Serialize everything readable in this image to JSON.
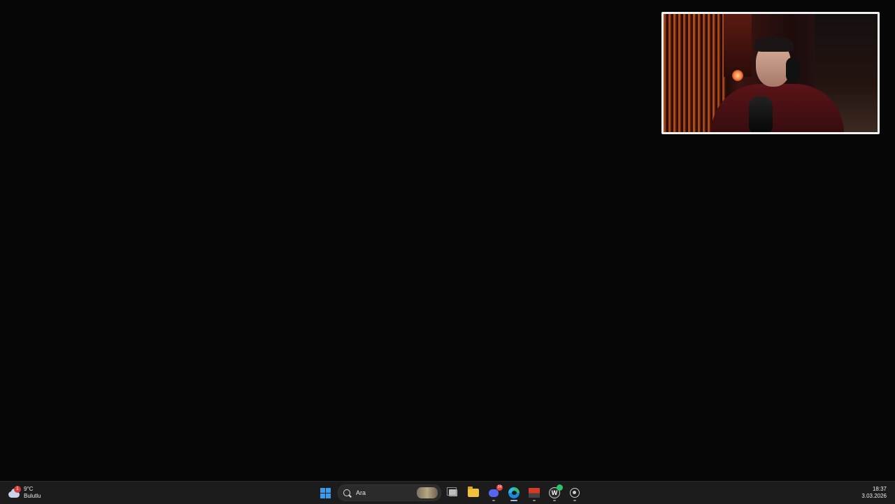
{
  "webcam": {
    "description_label": "webcam overlay"
  },
  "taskbar": {
    "weather": {
      "temperature": "9°C",
      "condition": "Bulutlu",
      "badge": "1"
    },
    "search": {
      "placeholder": "Ara"
    },
    "apps": [
      {
        "name": "start",
        "icon": "windows-logo-icon"
      },
      {
        "name": "task-view",
        "icon": "task-view-icon"
      },
      {
        "name": "file-explorer",
        "icon": "folder-icon"
      },
      {
        "name": "discord",
        "icon": "discord-icon",
        "badge": "24"
      },
      {
        "name": "edge",
        "icon": "edge-icon"
      },
      {
        "name": "media-app",
        "icon": "media-app-icon"
      },
      {
        "name": "w-app",
        "icon": "w-app-icon"
      },
      {
        "name": "obs",
        "icon": "obs-icon"
      }
    ],
    "clock": {
      "time": "18:37",
      "date": "3.03.2026"
    }
  }
}
